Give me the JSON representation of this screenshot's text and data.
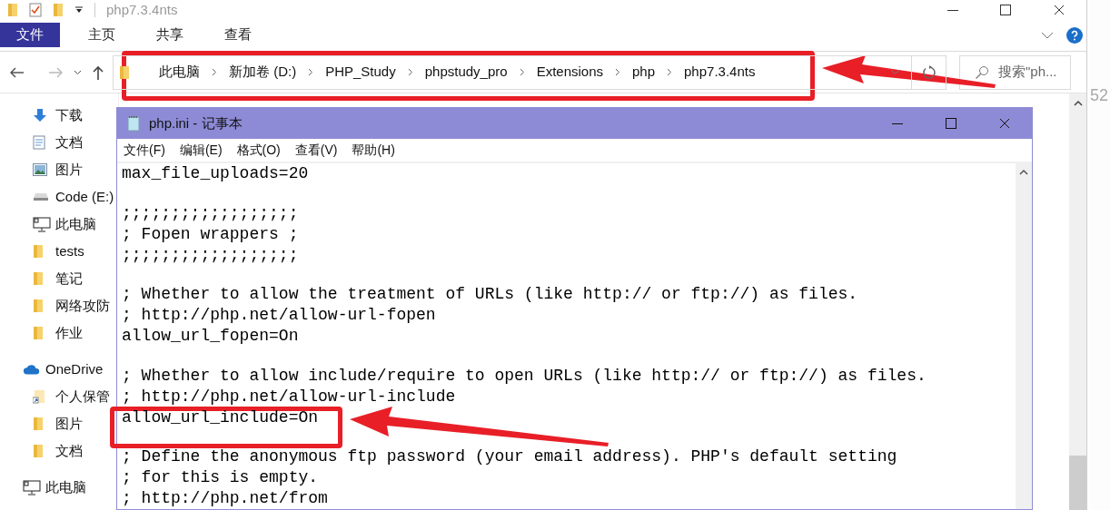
{
  "explorer": {
    "title": "php7.3.4nts",
    "ribbon_tabs": [
      {
        "label": "文件",
        "selected": true
      },
      {
        "label": "主页",
        "selected": false
      },
      {
        "label": "共享",
        "selected": false
      },
      {
        "label": "查看",
        "selected": false
      }
    ],
    "breadcrumb": [
      "此电脑",
      "新加卷 (D:)",
      "PHP_Study",
      "phpstudy_pro",
      "Extensions",
      "php",
      "php7.3.4nts"
    ],
    "search": {
      "placeholder": "搜索\"ph..."
    },
    "sidebar": {
      "quick_items": [
        {
          "label": "下载",
          "kind": "download"
        },
        {
          "label": "文档",
          "kind": "document"
        },
        {
          "label": "图片",
          "kind": "picture"
        },
        {
          "label": "Code (E:)",
          "kind": "drive"
        },
        {
          "label": "此电脑",
          "kind": "computer"
        },
        {
          "label": "tests",
          "kind": "folder"
        },
        {
          "label": "笔记",
          "kind": "folder"
        },
        {
          "label": "网络攻防",
          "kind": "folder"
        },
        {
          "label": "作业",
          "kind": "folder"
        }
      ],
      "groups": [
        {
          "label": "OneDrive",
          "kind": "cloud",
          "children": [
            {
              "label": "个人保管",
              "kind": "shortcut"
            },
            {
              "label": "图片",
              "kind": "folder"
            },
            {
              "label": "文档",
              "kind": "folder"
            }
          ]
        },
        {
          "label": "此电脑",
          "kind": "computer"
        }
      ]
    },
    "background_text": "52"
  },
  "notepad": {
    "title": "php.ini - 记事本",
    "menu": [
      "文件(F)",
      "编辑(E)",
      "格式(O)",
      "查看(V)",
      "帮助(H)"
    ],
    "lines": [
      {
        "kind": "code",
        "text": "max_file_uploads=20"
      },
      {
        "kind": "blank"
      },
      {
        "kind": "code",
        "text": ";;;;;;;;;;;;;;;;;;"
      },
      {
        "kind": "code",
        "text": "; Fopen wrappers ;"
      },
      {
        "kind": "code",
        "text": ";;;;;;;;;;;;;;;;;;"
      },
      {
        "kind": "blank"
      },
      {
        "kind": "code",
        "text": "; Whether to allow the treatment of URLs (like http:// or ftp://) as files."
      },
      {
        "kind": "code",
        "text": "; http://php.net/allow-url-fopen"
      },
      {
        "kind": "code",
        "text": "allow_url_fopen=On"
      },
      {
        "kind": "blank"
      },
      {
        "kind": "code",
        "text": "; Whether to allow include/require to open URLs (like http:// or ftp://) as files."
      },
      {
        "kind": "code",
        "text": "; http://php.net/allow-url-include"
      },
      {
        "kind": "code",
        "text": "allow_url_include=On"
      },
      {
        "kind": "blank"
      },
      {
        "kind": "code",
        "text": "; Define the anonymous ftp password (your email address). PHP's default setting"
      },
      {
        "kind": "code",
        "text": "; for this is empty."
      },
      {
        "kind": "code",
        "text": "; http://php.net/from"
      }
    ]
  }
}
